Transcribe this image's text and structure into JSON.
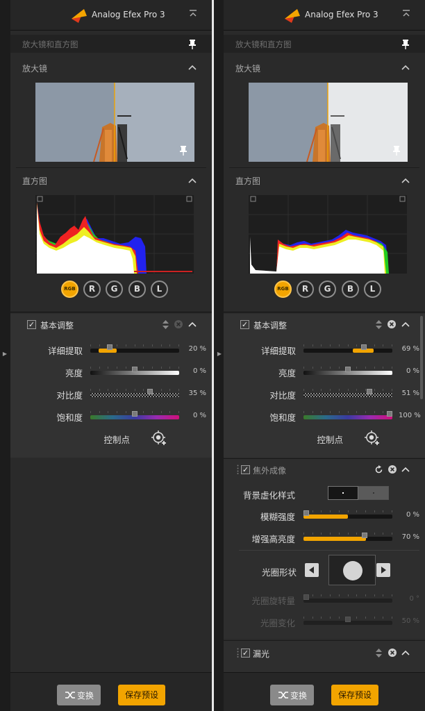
{
  "app": {
    "title": "Analog Efex Pro 3"
  },
  "section_loupe_histogram": "放大镜和直方图",
  "loupe_title": "放大镜",
  "histogram_title": "直方图",
  "channels": [
    "RGB",
    "R",
    "G",
    "B",
    "L"
  ],
  "basic_adjust": {
    "title": "基本调整",
    "rows": [
      {
        "label": "详细提取"
      },
      {
        "label": "亮度"
      },
      {
        "label": "对比度"
      },
      {
        "label": "饱和度"
      }
    ],
    "control_point_label": "控制点"
  },
  "left": {
    "values": [
      "20 %",
      "0 %",
      "35 %",
      "0 %"
    ],
    "levels": [
      0.2,
      0.5,
      0.68,
      0.5
    ]
  },
  "right": {
    "values": [
      "69 %",
      "0 %",
      "51 %",
      "100 %"
    ],
    "levels": [
      0.69,
      0.5,
      0.76,
      1.0
    ]
  },
  "defocus": {
    "title": "焦外成像",
    "bokeh_style_label": "背景虚化样式",
    "rows": [
      {
        "label": "模糊强度",
        "value": "0 %",
        "level": 0.0,
        "fill": 0.5
      },
      {
        "label": "增强高亮度",
        "value": "70 %",
        "level": 0.7,
        "fill": 0.7
      }
    ],
    "aperture_shape_label": "光圈形状",
    "disabled_rows": [
      {
        "label": "光圈旋转量",
        "value": "0 °",
        "level": 0.0
      },
      {
        "label": "光圈变化",
        "value": "50 %",
        "level": 0.5
      }
    ]
  },
  "light_leak": {
    "title": "漏光"
  },
  "footer": {
    "swap_label": "变换",
    "save_preset_label": "保存预设"
  },
  "colors": {
    "accent": "#f2a400",
    "panel": "#2a2a2a",
    "section": "#323232"
  }
}
